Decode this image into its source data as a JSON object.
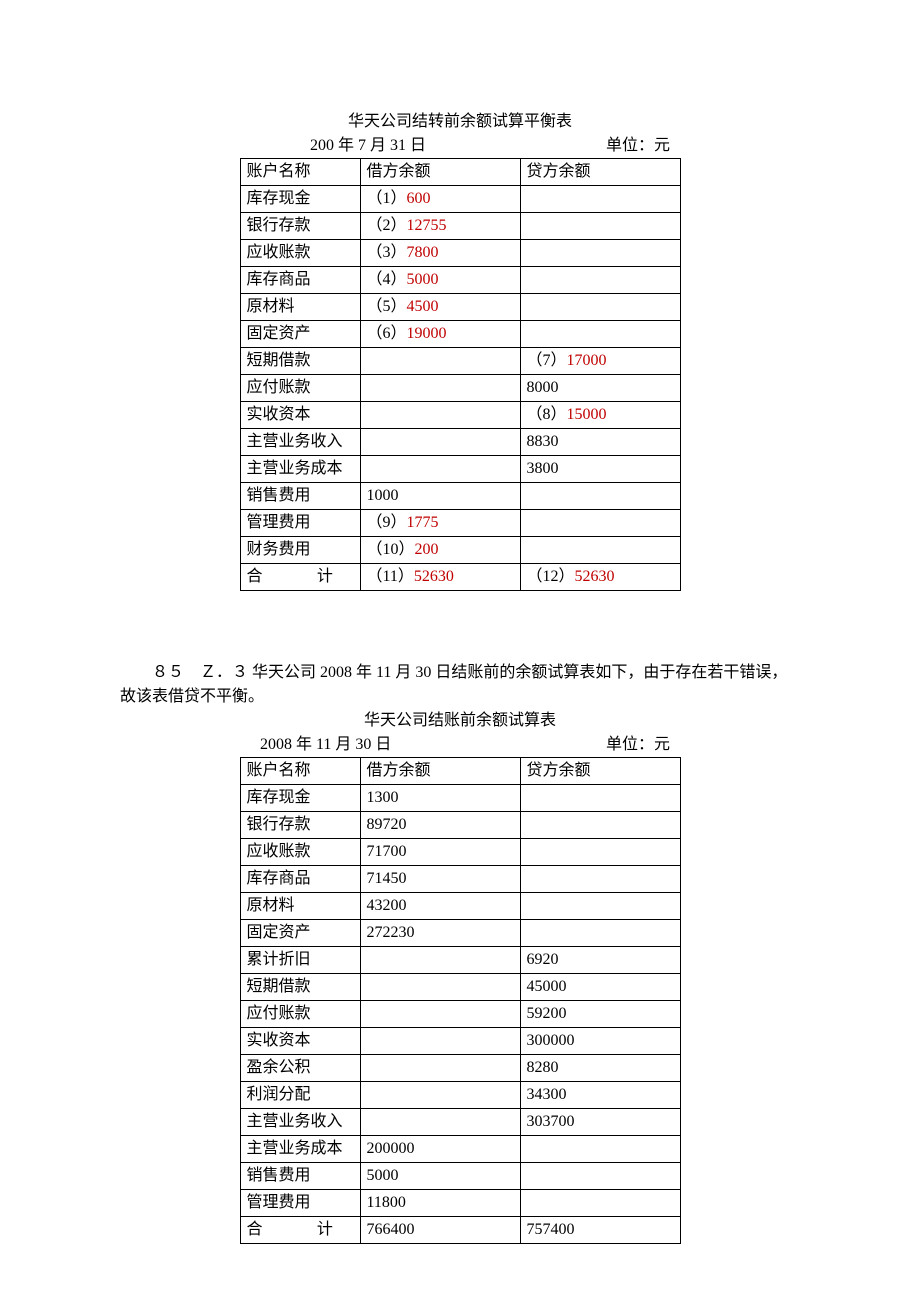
{
  "table1": {
    "title": "华天公司结转前余额试算平衡表",
    "date": "200 年 7 月 31 日",
    "unit": "单位：元",
    "head_name": "账户名称",
    "head_debit": "借方余额",
    "head_credit": "贷方余额",
    "sum_label": "合　计",
    "rows": [
      {
        "name": "库存现金",
        "dp": "（1）",
        "dv": "600",
        "cp": "",
        "cv": ""
      },
      {
        "name": "银行存款",
        "dp": "（2）",
        "dv": "12755",
        "cp": "",
        "cv": ""
      },
      {
        "name": "应收账款",
        "dp": "（3）",
        "dv": "7800",
        "cp": "",
        "cv": ""
      },
      {
        "name": "库存商品",
        "dp": "（4）",
        "dv": "5000",
        "cp": "",
        "cv": ""
      },
      {
        "name": "原材料",
        "dp": "（5）",
        "dv": "4500",
        "cp": "",
        "cv": ""
      },
      {
        "name": "固定资产",
        "dp": "（6）",
        "dv": "19000",
        "cp": "",
        "cv": ""
      },
      {
        "name": "短期借款",
        "dp": "",
        "dv": "",
        "cp": "（7）",
        "cv": "17000"
      },
      {
        "name": "应付账款",
        "dp": "",
        "dv": "",
        "cp": "",
        "cv": "8000",
        "cblack": true
      },
      {
        "name": "实收资本",
        "dp": "",
        "dv": "",
        "cp": "（8）",
        "cv": "15000"
      },
      {
        "name": "主营业务收入",
        "dp": "",
        "dv": "",
        "cp": "",
        "cv": "8830",
        "cblack": true
      },
      {
        "name": "主营业务成本",
        "dp": "",
        "dv": "",
        "cp": "",
        "cv": "3800",
        "cblack": true
      },
      {
        "name": "销售费用",
        "dp": "",
        "dv": "1000",
        "cp": "",
        "cv": "",
        "dblack": true
      },
      {
        "name": "管理费用",
        "dp": "（9）",
        "dv": "1775",
        "cp": "",
        "cv": ""
      },
      {
        "name": "财务费用",
        "dp": "（10）",
        "dv": "200",
        "cp": "",
        "cv": ""
      }
    ],
    "sum_dp": "（11）",
    "sum_dv": "52630",
    "sum_cp": "（12）",
    "sum_cv": "52630"
  },
  "paragraph": "８５　Ｚ．３ 华天公司 2008 年 11 月 30 日结账前的余额试算表如下，由于存在若干错误，故该表借贷不平衡。",
  "table2": {
    "title": "华天公司结账前余额试算表",
    "date": "2008 年 11 月 30 日",
    "unit": "单位：元",
    "head_name": "账户名称",
    "head_debit": "借方余额",
    "head_credit": "贷方余额",
    "sum_label": "合　计",
    "rows": [
      {
        "name": "库存现金",
        "d": "1300",
        "c": ""
      },
      {
        "name": "银行存款",
        "d": "89720",
        "c": ""
      },
      {
        "name": "应收账款",
        "d": "71700",
        "c": ""
      },
      {
        "name": "库存商品",
        "d": "71450",
        "c": ""
      },
      {
        "name": "原材料",
        "d": "43200",
        "c": ""
      },
      {
        "name": "固定资产",
        "d": "272230",
        "c": ""
      },
      {
        "name": "累计折旧",
        "d": "",
        "c": "6920"
      },
      {
        "name": "短期借款",
        "d": "",
        "c": "45000"
      },
      {
        "name": "应付账款",
        "d": "",
        "c": "59200"
      },
      {
        "name": "实收资本",
        "d": "",
        "c": "300000"
      },
      {
        "name": "盈余公积",
        "d": "",
        "c": "8280"
      },
      {
        "name": "利润分配",
        "d": "",
        "c": "34300"
      },
      {
        "name": "主营业务收入",
        "d": "",
        "c": "303700"
      },
      {
        "name": "主营业务成本",
        "d": "200000",
        "c": ""
      },
      {
        "name": "销售费用",
        "d": "5000",
        "c": ""
      },
      {
        "name": "管理费用",
        "d": "11800",
        "c": ""
      }
    ],
    "sum_d": "766400",
    "sum_c": "757400"
  }
}
